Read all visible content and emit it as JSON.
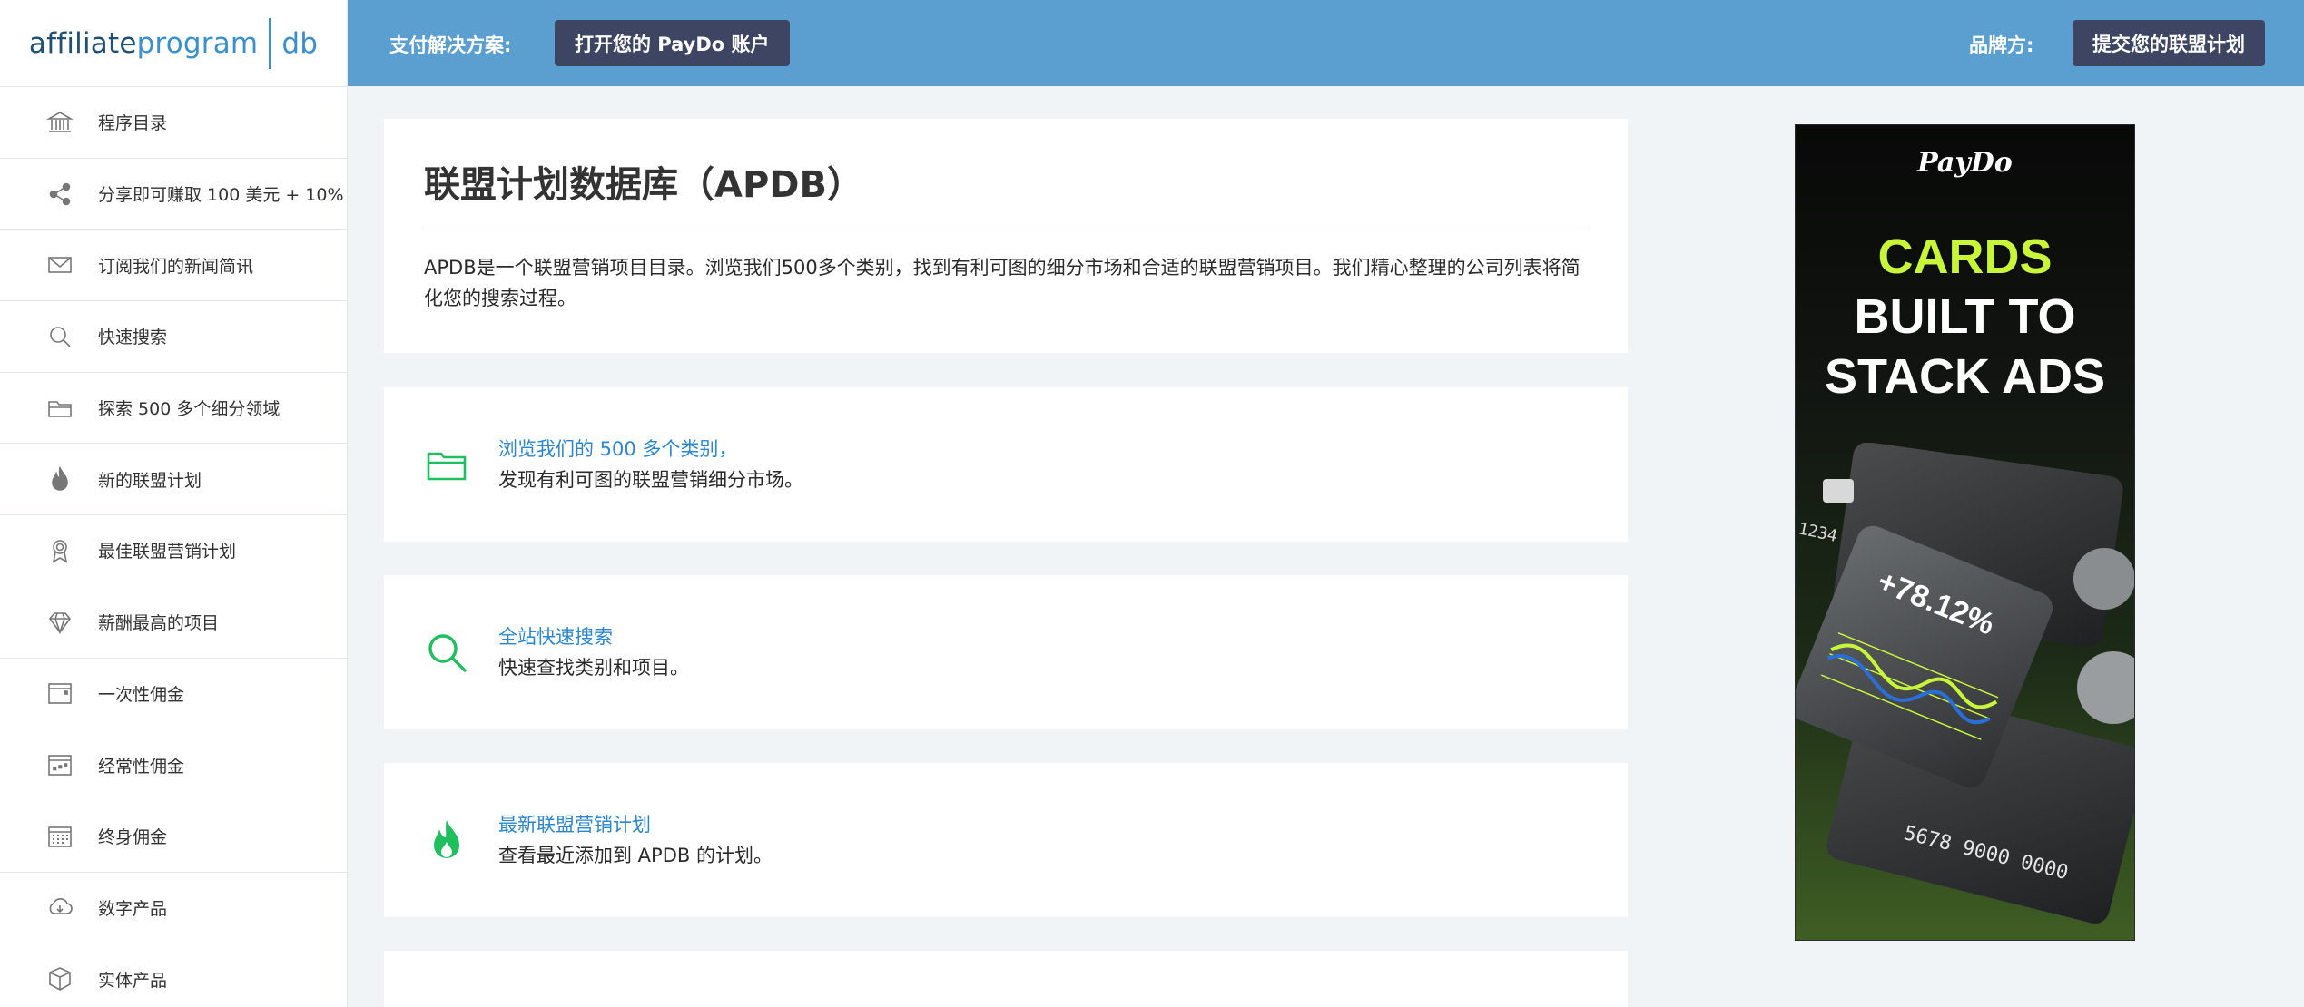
{
  "logo": {
    "part1": "affiliate",
    "part2": "program",
    "part3": "db"
  },
  "sidebar": {
    "items": [
      {
        "label": "程序目录",
        "icon": "bank-icon"
      },
      {
        "label": "分享即可赚取 100 美元 + 10%",
        "icon": "share-icon"
      },
      {
        "label": "订阅我们的新闻简讯",
        "icon": "envelope-icon"
      },
      {
        "label": "快速搜索",
        "icon": "search-icon"
      },
      {
        "label": "探索 500 多个细分领域",
        "icon": "folder-icon"
      },
      {
        "label": "新的联盟计划",
        "icon": "fire-icon"
      },
      {
        "label": "最佳联盟营销计划",
        "icon": "award-icon"
      },
      {
        "label": "薪酬最高的项目",
        "icon": "diamond-icon"
      },
      {
        "label": "一次性佣金",
        "icon": "calendar-one-icon"
      },
      {
        "label": "经常性佣金",
        "icon": "calendar-recurring-icon"
      },
      {
        "label": "终身佣金",
        "icon": "calendar-grid-icon"
      },
      {
        "label": "数字产品",
        "icon": "cloud-download-icon"
      },
      {
        "label": "实体产品",
        "icon": "box-icon"
      }
    ]
  },
  "topbar": {
    "payment_label": "支付解决方案:",
    "payment_button": "打开您的 PayDo 账户",
    "brand_label": "品牌方:",
    "brand_button": "提交您的联盟计划"
  },
  "hero": {
    "title": "联盟计划数据库（APDB）",
    "description": "APDB是一个联盟营销项目目录。浏览我们500多个类别，找到有利可图的细分市场和合适的联盟营销项目。我们精心整理的公司列表将简化您的搜索过程。"
  },
  "features": [
    {
      "link": "浏览我们的 500 多个类别，",
      "desc": "发现有利可图的联盟营销细分市场。",
      "icon": "folder-icon"
    },
    {
      "link": "全站快速搜索",
      "desc": "快速查找类别和项目。",
      "icon": "search-icon"
    },
    {
      "link": "最新联盟营销计划",
      "desc": "查看最近添加到 APDB 的计划。",
      "icon": "fire-icon"
    }
  ],
  "ad": {
    "brand": "PayDo",
    "headline_accent": "CARDS",
    "headline_line2": "BUILT TO",
    "headline_line3": "STACK ADS",
    "card_stat": "+78.12%",
    "card_number_a": "1234",
    "card_number_b": "5678 9000 0000",
    "colors": {
      "accent": "#c8f53a",
      "bg": "#0b0c0b"
    }
  },
  "colors": {
    "topbar": "#5b9fd1",
    "button": "#3d4563",
    "link": "#2a87d0",
    "feature_icon": "#1fbf5f"
  }
}
